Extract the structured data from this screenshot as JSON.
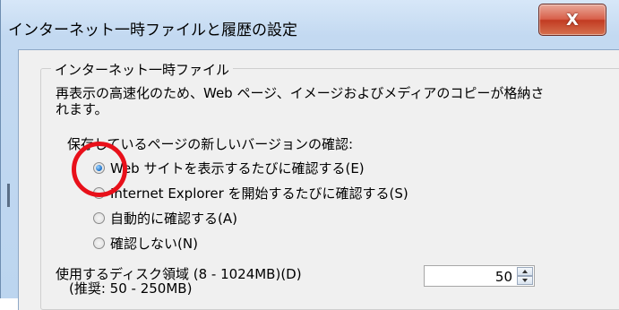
{
  "window": {
    "title": "インターネット一時ファイルと履歴の設定",
    "close_label": "X"
  },
  "group": {
    "legend": "インターネット一時ファイル",
    "description_line1": "再表示の高速化のため、Web ページ、イメージおよびメディアのコピーが格納さ",
    "description_line2": "れます。",
    "check_heading": "保存しているページの新しいバージョンの確認:",
    "options": [
      {
        "label": "Web サイトを表示するたびに確認する(E)",
        "checked": true
      },
      {
        "label": "Internet Explorer を開始するたびに確認する(S)",
        "checked": false
      },
      {
        "label": "自動的に確認する(A)",
        "checked": false
      },
      {
        "label": "確認しない(N)",
        "checked": false
      }
    ],
    "disk_label_line1": "使用するディスク領域 (8 - 1024MB)(D)",
    "disk_label_line2": "(推奨: 50 - 250MB)",
    "disk_value": "50"
  },
  "colors": {
    "highlight": "#e8101a",
    "close_button": "#c23b22"
  }
}
